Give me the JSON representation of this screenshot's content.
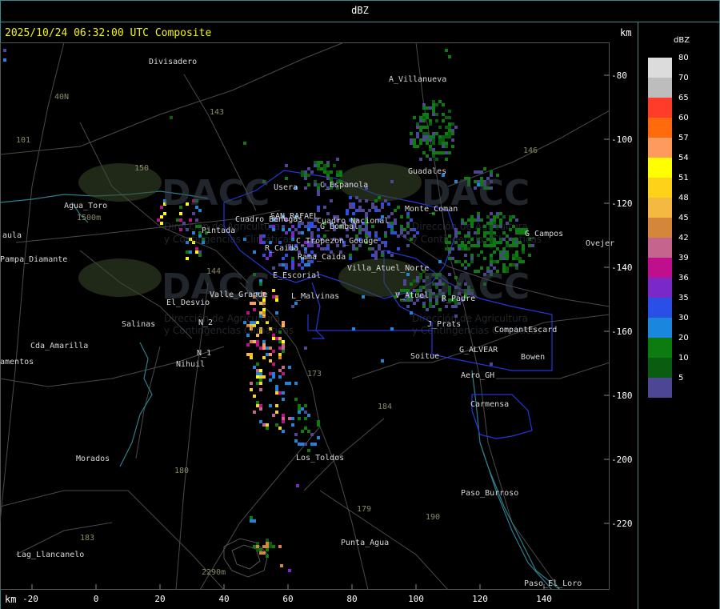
{
  "header": {
    "title": "dBZ"
  },
  "timestamp": "2025/10/24 06:32:00 UTC Composite",
  "axis": {
    "unit_top": "km",
    "unit_bottom": "km",
    "y_ticks": [
      "-80",
      "-100",
      "-120",
      "-140",
      "-160",
      "-180",
      "-200",
      "-220"
    ],
    "x_ticks": [
      "-20",
      "0",
      "20",
      "40",
      "60",
      "80",
      "100",
      "120",
      "140"
    ]
  },
  "legend": {
    "title": "dBZ",
    "entries": [
      {
        "label": "80",
        "color": "#dcdcdc"
      },
      {
        "label": "70",
        "color": "#bdbdbd"
      },
      {
        "label": "65",
        "color": "#ff3b2a"
      },
      {
        "label": "60",
        "color": "#ff6a0d"
      },
      {
        "label": "57",
        "color": "#ff9a5e"
      },
      {
        "label": "54",
        "color": "#ffff00"
      },
      {
        "label": "51",
        "color": "#ffd21a"
      },
      {
        "label": "48",
        "color": "#f4b940"
      },
      {
        "label": "45",
        "color": "#d4873a"
      },
      {
        "label": "42",
        "color": "#c5658e"
      },
      {
        "label": "39",
        "color": "#c00f8c"
      },
      {
        "label": "36",
        "color": "#7b28c8"
      },
      {
        "label": "35",
        "color": "#2a4fe6"
      },
      {
        "label": "30",
        "color": "#1a86dc"
      },
      {
        "label": "20",
        "color": "#0c7c10"
      },
      {
        "label": "10",
        "color": "#0a5c10"
      },
      {
        "label": "5",
        "color": "#4c4694"
      }
    ]
  },
  "places": [
    {
      "name": "Divisadero"
    },
    {
      "name": "A_Villanueva"
    },
    {
      "name": "40N"
    },
    {
      "name": "Agua_Toro"
    },
    {
      "name": "1500m"
    },
    {
      "name": "Pampa_Diamante"
    },
    {
      "name": "aula"
    },
    {
      "name": "Guadales"
    },
    {
      "name": "G_Campos"
    },
    {
      "name": "Ovejer"
    },
    {
      "name": "Pintada"
    },
    {
      "name": "R_Caida"
    },
    {
      "name": "E_Escorial"
    },
    {
      "name": "Valle_Grande"
    },
    {
      "name": "El_Desvio"
    },
    {
      "name": "L_Malvinas"
    },
    {
      "name": "Salinas"
    },
    {
      "name": "N_2"
    },
    {
      "name": "N_1"
    },
    {
      "name": "Nihuil"
    },
    {
      "name": "Cda_Amarilla"
    },
    {
      "name": "amentos"
    },
    {
      "name": "V_Atuel"
    },
    {
      "name": "R_Padre"
    },
    {
      "name": "J_Prats"
    },
    {
      "name": "CompantEscard"
    },
    {
      "name": "G_ALVEAR"
    },
    {
      "name": "Bowen"
    },
    {
      "name": "Soitue"
    },
    {
      "name": "Aero_GH"
    },
    {
      "name": "Carmensa"
    },
    {
      "name": "Los_Toldos"
    },
    {
      "name": "Morados"
    },
    {
      "name": "Paso_Burroso"
    },
    {
      "name": "Punta_Agua"
    },
    {
      "name": "Lag_Llancanelo"
    },
    {
      "name": "Paso_El_Loro"
    },
    {
      "name": "2290m"
    },
    {
      "name": "Usera"
    },
    {
      "name": "C_Espanola"
    },
    {
      "name": "Cuadro_Benegas"
    },
    {
      "name": "SAN_RAFAEL"
    },
    {
      "name": "Cuadro_Nacional"
    },
    {
      "name": "C_Tropezon_Goudge"
    },
    {
      "name": "Villa_Atuel_Norte"
    },
    {
      "name": "Rama_Caida"
    },
    {
      "name": "Monte_Coman"
    },
    {
      "name": "G_Bombal"
    }
  ],
  "routes": [
    {
      "name": "143"
    },
    {
      "name": "150"
    },
    {
      "name": "101"
    },
    {
      "name": "144"
    },
    {
      "name": "146"
    },
    {
      "name": "173"
    },
    {
      "name": "184"
    },
    {
      "name": "180"
    },
    {
      "name": "179"
    },
    {
      "name": "190"
    },
    {
      "name": "183"
    }
  ],
  "watermark": {
    "brand": "DACC",
    "line1": "Dirección de Agricultura",
    "line2": "y Contingencias Climáticas"
  }
}
